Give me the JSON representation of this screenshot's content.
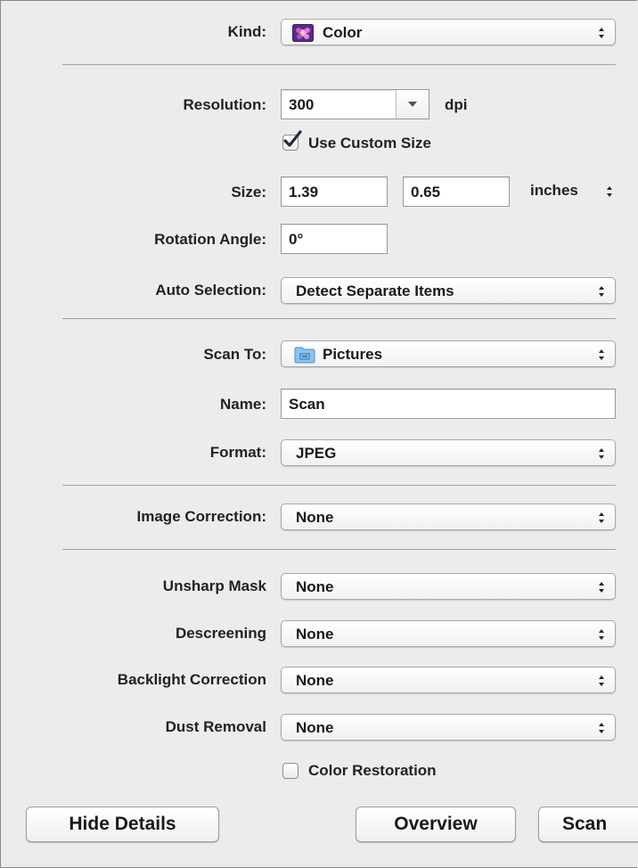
{
  "settings": {
    "kind": {
      "label": "Kind:",
      "value": "Color",
      "icon": "color-photo-icon"
    },
    "resolution": {
      "label": "Resolution:",
      "value": "300",
      "unit": "dpi"
    },
    "custom_size": {
      "label": "Use Custom Size",
      "checked": true
    },
    "size": {
      "label": "Size:",
      "width": "1.39",
      "height": "0.65",
      "unit": "inches"
    },
    "rotation": {
      "label": "Rotation Angle:",
      "value": "0°"
    },
    "auto_selection": {
      "label": "Auto Selection:",
      "value": "Detect Separate Items"
    },
    "scan_to": {
      "label": "Scan To:",
      "value": "Pictures",
      "icon": "folder-icon"
    },
    "name": {
      "label": "Name:",
      "value": "Scan"
    },
    "format": {
      "label": "Format:",
      "value": "JPEG"
    },
    "image_correction": {
      "label": "Image Correction:",
      "value": "None"
    },
    "unsharp_mask": {
      "label": "Unsharp Mask",
      "value": "None"
    },
    "descreening": {
      "label": "Descreening",
      "value": "None"
    },
    "backlight_correction": {
      "label": "Backlight Correction",
      "value": "None"
    },
    "dust_removal": {
      "label": "Dust Removal",
      "value": "None"
    },
    "color_restoration": {
      "label": "Color Restoration",
      "checked": false
    }
  },
  "buttons": {
    "hide_details": "Hide Details",
    "overview": "Overview",
    "scan": "Scan"
  },
  "colors": {
    "checkmark": "#1f2a44",
    "folder": "#7ab4e6",
    "color_icon": "#6b2fa0"
  }
}
